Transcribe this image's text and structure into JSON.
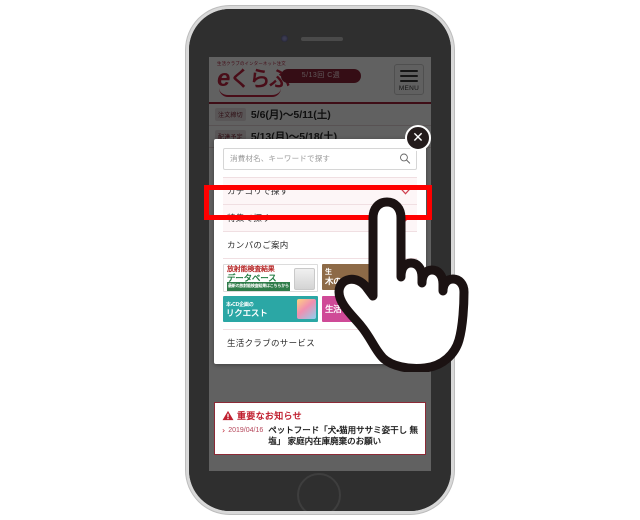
{
  "device": {
    "kind": "smartphone-mockup",
    "camera_icon": "front-camera-icon",
    "earpiece_icon": "earpiece-speaker-icon",
    "home_button_icon": "home-button-icon"
  },
  "site_header": {
    "tagline": "生活クラブのインターネット注文",
    "logo_text": "eくらぶ",
    "logo_e": "e",
    "logo_rest": "くらぶ",
    "week_badge": "5/13回 C週",
    "menu_label": "MENU",
    "menu_icon": "hamburger-menu-icon"
  },
  "schedule": [
    {
      "tag": "注文締切",
      "value": "5/6(月)〜5/11(土)"
    },
    {
      "tag": "配達予定",
      "value": "5/13(月)〜5/18(土)"
    }
  ],
  "modal": {
    "close_icon": "close-x-icon",
    "close_label": "✕",
    "search": {
      "placeholder": "消費材名、キーワードで探す",
      "value": "",
      "icon": "search-icon"
    },
    "menu_items": [
      {
        "label": "カテゴリで探す",
        "icon": "chevron-down-icon",
        "highlighted": true
      },
      {
        "label": "特集で探す",
        "icon": "chevron-down-icon",
        "highlighted": false
      },
      {
        "label": "カンパのご案内",
        "icon": "",
        "highlighted": false
      }
    ],
    "banners": [
      {
        "id": "radiation-db",
        "line1": "放射能検査結果",
        "line2": "データベース",
        "line3": "最新の放射能検査結果はこちらから",
        "thumb_icon": "measuring-device-icon"
      },
      {
        "id": "wood",
        "line1": "生",
        "line2": "木の",
        "line3": "",
        "thumb_icon": "wood-icon"
      },
      {
        "id": "book-cd-request",
        "line1": "本・CD企画の",
        "line2": "リクエスト",
        "line3": "",
        "thumb_icon": "books-stack-icon"
      },
      {
        "id": "seikatsu-club",
        "line1": "",
        "line2": "生活クラ",
        "line3": "",
        "thumb_icon": ""
      }
    ],
    "footer_item": {
      "label": "生活クラブのサービス",
      "icon": "chevron-down-icon"
    }
  },
  "notice": {
    "warn_icon": "warning-triangle-icon",
    "title": "重要なお知らせ",
    "arrow_icon": "chevron-right-icon",
    "arrow_glyph": "›",
    "date": "2019/04/16",
    "text": "ペットフード「犬・猫用ササミ姿干し 無塩」 家庭内在庫廃棄のお願い"
  },
  "annotations": {
    "highlight_color": "#ff0000",
    "highlight_target": "カテゴリで探す",
    "cursor_icon": "pointing-hand-cursor-icon"
  },
  "colors": {
    "brand_red": "#c0233f",
    "accent_red": "#ff0000",
    "notice_red": "#c02030",
    "device_body": "#2b2b2b",
    "scrim": "rgba(0,0,0,0.62)"
  }
}
